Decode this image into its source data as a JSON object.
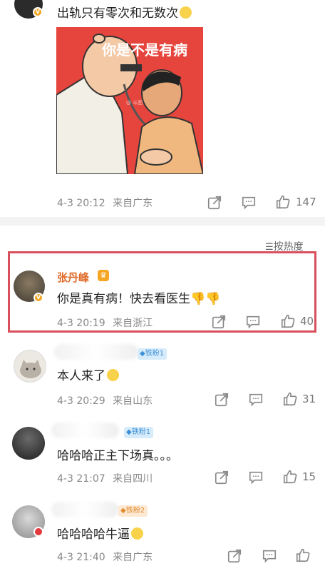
{
  "top_comment": {
    "text": "出轨只有零次和无数次",
    "meme_caption": "你是不是有病",
    "meme_watermark": "@ 斗图",
    "date": "4-3",
    "time": "20:12",
    "location": "来自广东",
    "likes": "147"
  },
  "sort_label": "按热度",
  "replies": [
    {
      "nickname": "张丹峰",
      "text": "你是真有病！快去看医生",
      "date": "4-3",
      "time": "20:19",
      "location": "来自浙江",
      "likes": "40",
      "highlighted": true
    },
    {
      "badge": "铁粉1",
      "text": "本人来了",
      "date": "4-3",
      "time": "20:29",
      "location": "来自山东",
      "likes": "31"
    },
    {
      "badge": "铁粉1",
      "text": "哈哈哈正主下场真。。。",
      "date": "4-3",
      "time": "21:07",
      "location": "来自四川",
      "likes": "15"
    },
    {
      "badge": "铁粉2",
      "text": "哈哈哈哈牛逼",
      "date": "4-3",
      "time": "21:40",
      "location": "来自广东",
      "likes": ""
    }
  ],
  "colors": {
    "highlight_border": "#d94f5c",
    "nickname": "#e06b2a",
    "meme_bg": "#e8413a"
  }
}
